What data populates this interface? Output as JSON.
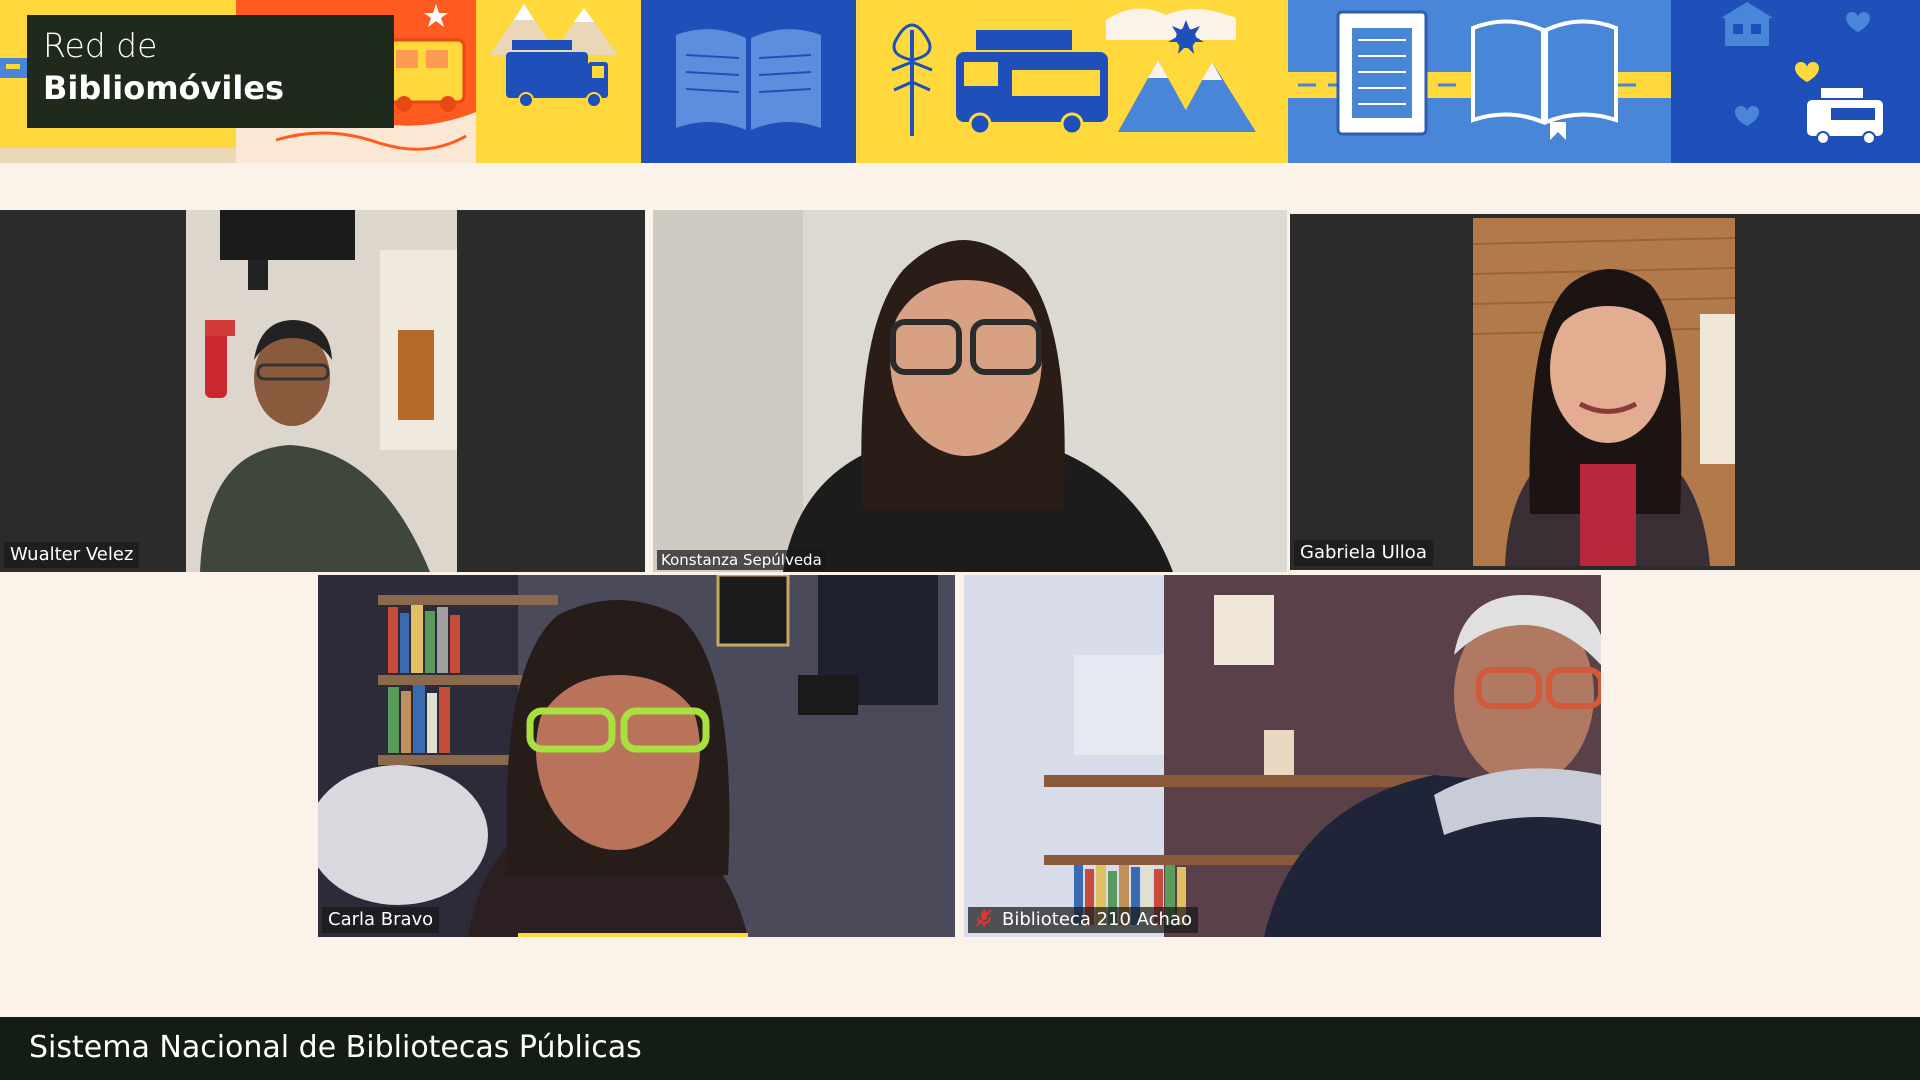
{
  "banner": {
    "title_line1": "Red de",
    "title_line2": "Bibliomóviles",
    "colors": {
      "yellow": "#ffd93b",
      "orange": "#ff5a1f",
      "blue": "#1f4fb8",
      "light_blue": "#4a86d8",
      "dark_green": "#1f2a1c"
    },
    "illustrations": [
      "star-icon",
      "van-icon",
      "mountains-icon",
      "open-book-icon",
      "tree-icon",
      "bookmobile-icon",
      "sun-icon",
      "book-icon",
      "house-icon",
      "heart-icon"
    ]
  },
  "participants": [
    {
      "name": "Wualter Velez",
      "muted": false,
      "active_speaker": false
    },
    {
      "name": "Konstanza Sepúlveda",
      "muted": false,
      "active_speaker": false
    },
    {
      "name": "Gabriela Ulloa",
      "muted": false,
      "active_speaker": true
    },
    {
      "name": "Carla Bravo",
      "muted": false,
      "active_speaker": false
    },
    {
      "name": "Biblioteca 210 Achao",
      "muted": true,
      "active_speaker": false
    }
  ],
  "active_speaker_color": "#a6d84a",
  "footer": {
    "text": "Sistema Nacional de Bibliotecas Públicas"
  }
}
